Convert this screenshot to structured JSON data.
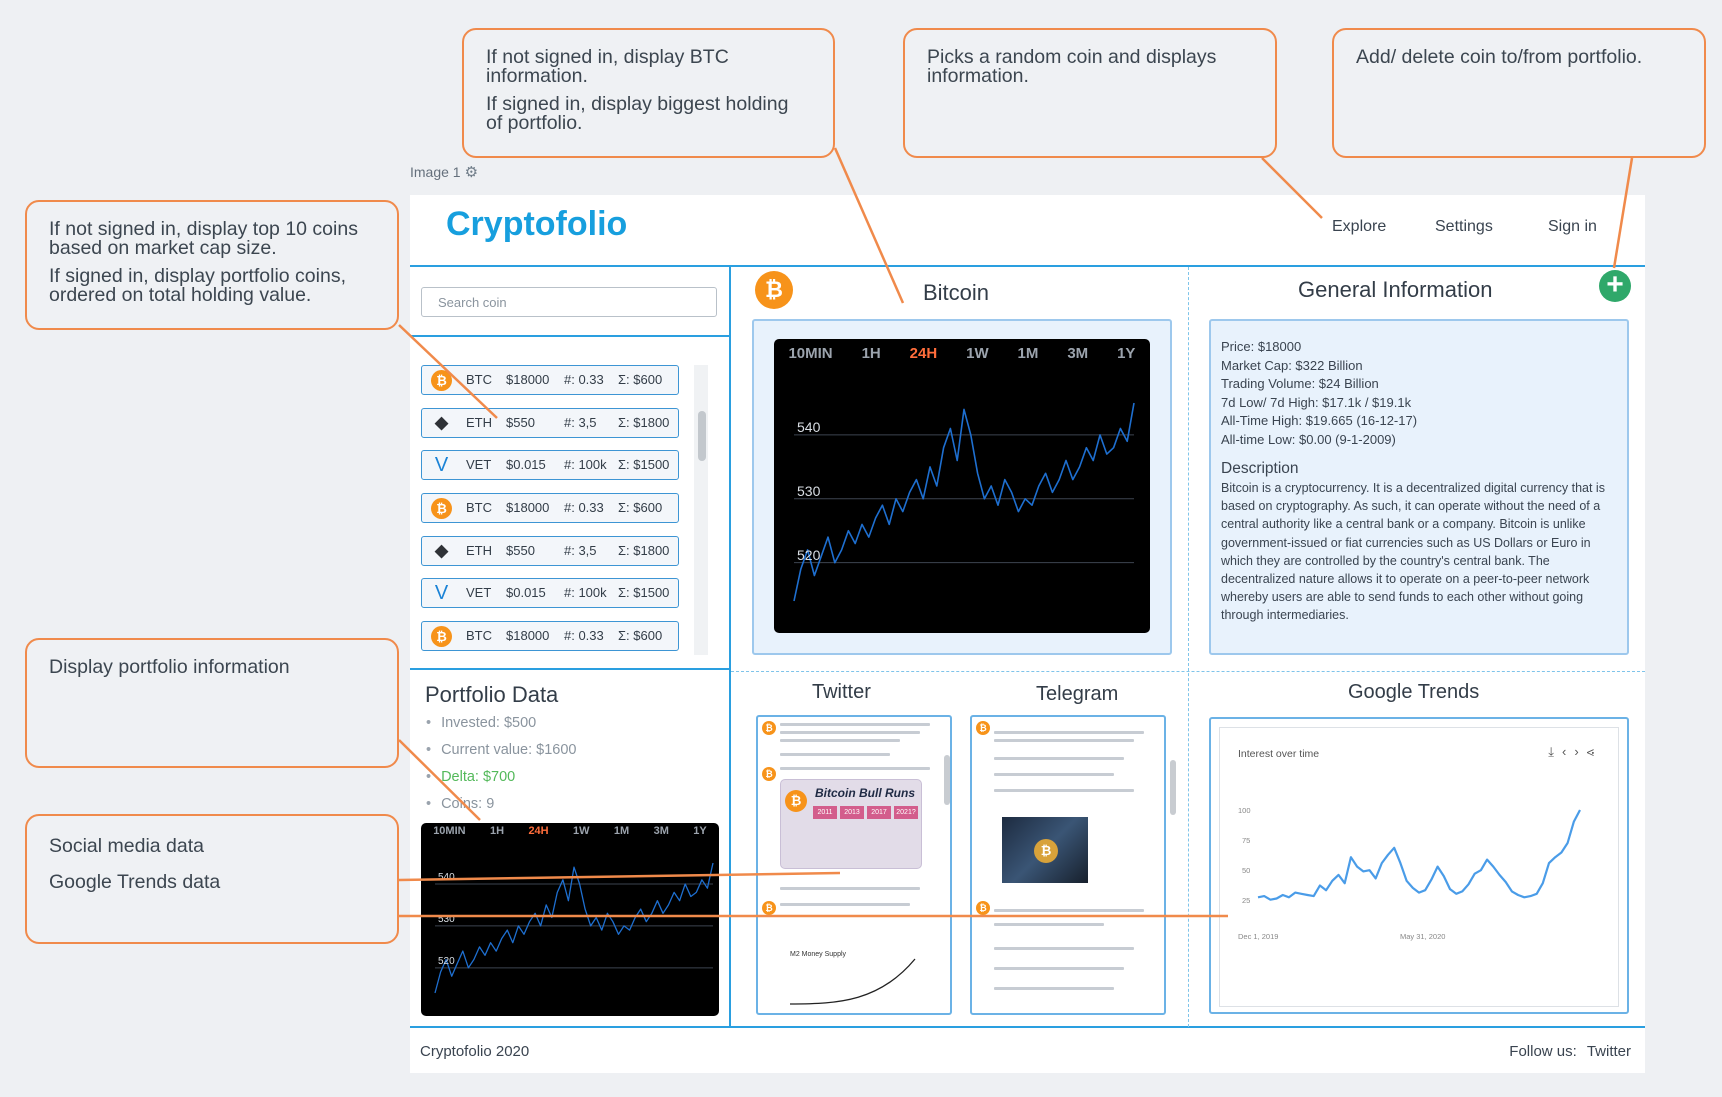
{
  "annotations": {
    "btc_info": [
      "If not signed in, display BTC information.",
      "If signed in, display biggest holding of portfolio."
    ],
    "random_coin": "Picks a random coin and displays information.",
    "add_delete": "Add/ delete coin to/from portfolio.",
    "top_coins": [
      "If not signed in, display top 10 coins based on market cap size.",
      "If signed in, display portfolio coins, ordered on total holding value."
    ],
    "portfolio_info": "Display portfolio information",
    "social": [
      "Social media data",
      "Google Trends data"
    ]
  },
  "image_label": "Image 1",
  "app": {
    "logo": "Cryptofolio",
    "nav": [
      "Explore",
      "Settings",
      "Sign in"
    ],
    "search_placeholder": "Search coin",
    "coin_list": [
      {
        "symbol": "BTC",
        "price": "$18000",
        "amount": "#: 0.33",
        "total": "Σ: $600",
        "icon": "bitcoin-icon"
      },
      {
        "symbol": "ETH",
        "price": "$550",
        "amount": "#: 3,5",
        "total": "Σ: $1800",
        "icon": "ethereum-icon"
      },
      {
        "symbol": "VET",
        "price": "$0.015",
        "amount": "#: 100k",
        "total": "Σ: $1500",
        "icon": "vechain-icon"
      },
      {
        "symbol": "BTC",
        "price": "$18000",
        "amount": "#: 0.33",
        "total": "Σ: $600",
        "icon": "bitcoin-icon"
      },
      {
        "symbol": "ETH",
        "price": "$550",
        "amount": "#: 3,5",
        "total": "Σ: $1800",
        "icon": "ethereum-icon"
      },
      {
        "symbol": "VET",
        "price": "$0.015",
        "amount": "#: 100k",
        "total": "Σ: $1500",
        "icon": "vechain-icon"
      },
      {
        "symbol": "BTC",
        "price": "$18000",
        "amount": "#: 0.33",
        "total": "Σ: $600",
        "icon": "bitcoin-icon"
      }
    ],
    "portfolio": {
      "title": "Portfolio Data",
      "invested": "Invested: $500",
      "current_value": "Current value: $1600",
      "delta": "Delta: $700",
      "coins": "Coins: 9"
    },
    "coin_title": "Bitcoin",
    "chart_tabs": [
      "10MIN",
      "1H",
      "24H",
      "1W",
      "1M",
      "3M",
      "1Y"
    ],
    "chart_active_tab": "24H",
    "general_info": {
      "title": "General Information",
      "lines": [
        "Price: $18000",
        "Market Cap: $322 Billion",
        "Trading Volume: $24 Billion",
        "7d Low/ 7d High: $17.1k / $19.1k",
        "All-Time High: $19.665  (16-12-17)",
        "All-time Low: $0.00  (9-1-2009)"
      ],
      "description_title": "Description",
      "description": "Bitcoin is a cryptocurrency. It is a decentralized digital currency that is based on cryptography. As such, it can operate without the need of a central authority like a central bank or a company. Bitcoin is unlike government-issued or fiat currencies such as US Dollars or Euro in which they are controlled by the country's central bank. The decentralized nature allows it to operate on a peer-to-peer network whereby users are able to send funds to each other without going through intermediaries."
    },
    "social": {
      "twitter_title": "Twitter",
      "telegram_title": "Telegram",
      "bull_runs": "Bitcoin Bull Runs",
      "bull_years": [
        "2011",
        "2013",
        "2017",
        "2021?"
      ],
      "money_supply": "M2 Money Supply",
      "trends_title": "Google Trends",
      "trends_subtitle": "Interest over time",
      "trends_yticks": [
        "100",
        "75",
        "50",
        "25"
      ],
      "trends_xticks": [
        "Dec 1, 2019",
        "May 31, 2020"
      ]
    },
    "footer": {
      "copyright": "Cryptofolio 2020",
      "follow": "Follow us:",
      "twitter": "Twitter"
    }
  },
  "chart_data": [
    {
      "type": "line",
      "title": "Bitcoin",
      "yticks": [
        520,
        530,
        540
      ],
      "ylim": [
        514,
        545
      ],
      "series": [
        {
          "values": [
            514,
            519,
            522,
            518,
            521,
            524,
            520,
            522,
            525,
            523,
            526,
            524,
            527,
            529,
            526,
            530,
            528,
            531,
            533,
            530,
            535,
            532,
            538,
            541,
            536,
            544,
            540,
            534,
            530,
            532,
            529,
            533,
            531,
            528,
            530,
            529,
            532,
            534,
            531,
            533,
            536,
            533,
            535,
            538,
            536,
            540,
            537,
            538,
            541,
            539,
            545
          ]
        }
      ]
    },
    {
      "type": "line",
      "title": "Portfolio Data",
      "yticks": [
        520,
        530,
        540
      ],
      "ylim": [
        514,
        545
      ],
      "series": [
        {
          "values": [
            514,
            519,
            522,
            518,
            521,
            524,
            520,
            522,
            525,
            523,
            526,
            524,
            527,
            529,
            526,
            530,
            528,
            531,
            533,
            530,
            535,
            532,
            538,
            541,
            536,
            544,
            540,
            534,
            530,
            532,
            529,
            533,
            531,
            528,
            530,
            529,
            532,
            534,
            531,
            533,
            536,
            533,
            535,
            538,
            536,
            540,
            537,
            538,
            541,
            539,
            545
          ]
        }
      ]
    },
    {
      "type": "line",
      "title": "Google Trends",
      "ylim": [
        0,
        100
      ],
      "series": [
        {
          "values": [
            26,
            27,
            24,
            25,
            28,
            26,
            30,
            29,
            28,
            27,
            36,
            32,
            40,
            45,
            38,
            60,
            52,
            48,
            49,
            42,
            55,
            62,
            68,
            55,
            40,
            34,
            30,
            32,
            41,
            52,
            44,
            33,
            29,
            31,
            37,
            46,
            49,
            58,
            52,
            45,
            39,
            31,
            28,
            26,
            27,
            29,
            38,
            55,
            60,
            64,
            72,
            90,
            100
          ]
        }
      ]
    }
  ]
}
